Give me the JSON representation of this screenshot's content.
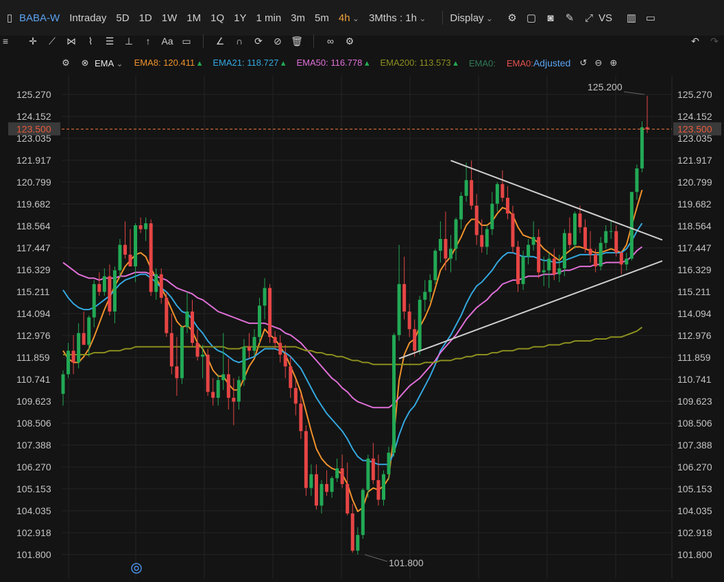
{
  "toolbar": {
    "symbol": "BABA-W",
    "periods": [
      "Intraday",
      "5D",
      "1D",
      "1W",
      "1M",
      "1Q",
      "1Y",
      "1 min",
      "3m",
      "5m",
      "4h"
    ],
    "active_period": "4h",
    "range": "3Mths : 1h",
    "display": "Display",
    "vs": "VS"
  },
  "drawing_tools": {
    "text_tool": "Aa"
  },
  "indicator": {
    "name": "EMA",
    "lines": [
      {
        "label": "EMA8:",
        "value": "120.411",
        "color": "#f0922c"
      },
      {
        "label": "EMA21:",
        "value": "118.727",
        "color": "#34a8e0"
      },
      {
        "label": "EMA50:",
        "value": "116.778",
        "color": "#e070d8"
      },
      {
        "label": "EMA200:",
        "value": "113.573",
        "color": "#8c8f1e"
      },
      {
        "label": "EMA0:",
        "value": "",
        "color": "#2f7a56"
      },
      {
        "label": "EMA0:",
        "value": "",
        "color": "#e85050"
      }
    ],
    "adjusted": "Adjusted"
  },
  "colors": {
    "up": "#22a955",
    "down": "#e64545",
    "price_line": "#f07a3c",
    "trendline": "#cfcfcf"
  },
  "chart_data": {
    "type": "candlestick",
    "y_ticks": [
      "125.270",
      "124.152",
      "123.035",
      "121.917",
      "120.799",
      "119.682",
      "118.564",
      "117.447",
      "116.329",
      "115.211",
      "114.094",
      "112.976",
      "111.859",
      "110.741",
      "109.623",
      "108.506",
      "107.388",
      "106.270",
      "105.153",
      "104.035",
      "102.918",
      "101.800"
    ],
    "ylim": [
      101.8,
      125.27
    ],
    "current_price": "123.500",
    "high_label": "125.200",
    "low_label": "101.800",
    "candles": [
      [
        110.0,
        111.2,
        109.4,
        111.0
      ],
      [
        111.0,
        112.6,
        110.8,
        112.2
      ],
      [
        112.2,
        113.0,
        111.0,
        111.6
      ],
      [
        111.6,
        113.6,
        111.3,
        113.1
      ],
      [
        113.1,
        114.2,
        112.7,
        112.5
      ],
      [
        112.5,
        114.0,
        111.9,
        113.9
      ],
      [
        113.9,
        115.8,
        113.4,
        115.6
      ],
      [
        115.6,
        116.2,
        115.0,
        115.2
      ],
      [
        115.2,
        116.4,
        115.0,
        116.0
      ],
      [
        116.0,
        116.6,
        114.0,
        114.2
      ],
      [
        114.2,
        116.5,
        113.6,
        116.3
      ],
      [
        116.3,
        117.9,
        115.9,
        117.6
      ],
      [
        117.6,
        118.8,
        116.9,
        117.1
      ],
      [
        117.1,
        118.4,
        116.5,
        116.5
      ],
      [
        116.5,
        118.7,
        115.7,
        118.6
      ],
      [
        118.6,
        119.0,
        118.2,
        118.4
      ],
      [
        118.4,
        119.0,
        117.8,
        118.7
      ],
      [
        118.7,
        118.9,
        115.0,
        115.2
      ],
      [
        115.2,
        116.4,
        114.8,
        116.1
      ],
      [
        116.1,
        116.4,
        114.6,
        114.9
      ],
      [
        114.9,
        115.2,
        112.9,
        113.1
      ],
      [
        113.1,
        114.1,
        111.0,
        111.4
      ],
      [
        111.4,
        112.9,
        109.9,
        110.8
      ],
      [
        110.8,
        113.5,
        110.5,
        113.4
      ],
      [
        113.4,
        115.2,
        113.1,
        114.2
      ],
      [
        114.2,
        114.8,
        112.4,
        112.6
      ],
      [
        112.6,
        113.3,
        111.7,
        111.9
      ],
      [
        111.9,
        112.5,
        110.8,
        112.0
      ],
      [
        112.0,
        112.3,
        109.9,
        110.1
      ],
      [
        110.1,
        110.8,
        109.4,
        109.8
      ],
      [
        109.8,
        111.0,
        109.4,
        110.7
      ],
      [
        110.7,
        113.1,
        110.2,
        111.0
      ],
      [
        111.0,
        111.8,
        109.2,
        109.8
      ],
      [
        109.8,
        110.8,
        108.4,
        109.6
      ],
      [
        109.6,
        110.9,
        109.2,
        110.7
      ],
      [
        110.7,
        112.8,
        110.4,
        112.4
      ],
      [
        112.4,
        113.1,
        111.8,
        112.2
      ],
      [
        112.2,
        113.3,
        111.9,
        112.9
      ],
      [
        112.9,
        114.9,
        112.6,
        114.5
      ],
      [
        114.5,
        115.9,
        113.8,
        115.4
      ],
      [
        115.4,
        115.6,
        112.6,
        112.9
      ],
      [
        112.9,
        113.2,
        112.3,
        112.6
      ],
      [
        112.6,
        113.0,
        111.6,
        112.0
      ],
      [
        112.0,
        112.5,
        110.8,
        111.4
      ],
      [
        111.4,
        111.9,
        109.8,
        110.3
      ],
      [
        110.3,
        110.7,
        108.9,
        109.5
      ],
      [
        109.5,
        110.0,
        107.7,
        108.1
      ],
      [
        108.1,
        108.4,
        104.8,
        105.2
      ],
      [
        105.2,
        106.4,
        104.8,
        105.9
      ],
      [
        105.9,
        106.4,
        104.1,
        104.3
      ],
      [
        104.3,
        105.6,
        103.9,
        105.4
      ],
      [
        105.4,
        106.1,
        104.8,
        105.0
      ],
      [
        105.0,
        105.8,
        104.7,
        105.7
      ],
      [
        105.7,
        106.7,
        105.5,
        106.2
      ],
      [
        106.2,
        106.9,
        105.2,
        105.4
      ],
      [
        105.4,
        106.5,
        103.8,
        103.9
      ],
      [
        103.9,
        104.4,
        101.9,
        102.0
      ],
      [
        102.0,
        103.2,
        101.8,
        102.8
      ],
      [
        102.8,
        105.2,
        102.6,
        105.1
      ],
      [
        105.1,
        106.9,
        104.7,
        106.7
      ],
      [
        106.7,
        107.5,
        105.4,
        105.6
      ],
      [
        105.6,
        106.9,
        104.3,
        104.6
      ],
      [
        104.6,
        106.1,
        104.3,
        105.9
      ],
      [
        105.9,
        107.3,
        105.6,
        107.0
      ],
      [
        107.0,
        113.1,
        106.8,
        113.0
      ],
      [
        113.0,
        117.6,
        112.7,
        115.6
      ],
      [
        115.6,
        117.0,
        113.8,
        114.2
      ],
      [
        114.2,
        114.6,
        112.9,
        113.3
      ],
      [
        113.3,
        113.8,
        111.9,
        112.2
      ],
      [
        112.2,
        115.0,
        112.0,
        114.8
      ],
      [
        114.8,
        115.8,
        114.2,
        115.2
      ],
      [
        115.2,
        116.1,
        114.7,
        115.8
      ],
      [
        115.8,
        117.4,
        115.6,
        117.3
      ],
      [
        117.3,
        118.8,
        116.7,
        117.9
      ],
      [
        117.9,
        119.3,
        116.3,
        116.9
      ],
      [
        116.9,
        118.1,
        116.2,
        117.4
      ],
      [
        117.4,
        119.0,
        116.8,
        118.9
      ],
      [
        118.9,
        120.3,
        118.4,
        120.1
      ],
      [
        120.1,
        121.8,
        119.8,
        120.9
      ],
      [
        120.9,
        121.9,
        119.4,
        119.6
      ],
      [
        119.6,
        120.2,
        117.6,
        118.1
      ],
      [
        118.1,
        118.9,
        117.2,
        117.5
      ],
      [
        117.5,
        118.6,
        117.1,
        118.4
      ],
      [
        118.4,
        120.3,
        118.1,
        119.7
      ],
      [
        119.7,
        120.8,
        119.3,
        120.7
      ],
      [
        120.7,
        121.4,
        119.8,
        120.0
      ],
      [
        120.0,
        120.6,
        118.9,
        119.2
      ],
      [
        119.2,
        119.6,
        117.2,
        117.5
      ],
      [
        117.5,
        117.8,
        115.2,
        115.6
      ],
      [
        115.6,
        117.3,
        115.3,
        117.0
      ],
      [
        117.0,
        117.9,
        116.6,
        117.6
      ],
      [
        117.6,
        118.8,
        117.3,
        118.0
      ],
      [
        118.0,
        118.4,
        115.9,
        116.2
      ],
      [
        116.2,
        117.0,
        115.5,
        116.3
      ],
      [
        116.3,
        117.2,
        115.4,
        116.9
      ],
      [
        116.9,
        117.4,
        115.8,
        116.1
      ],
      [
        116.1,
        117.1,
        115.7,
        116.4
      ],
      [
        116.4,
        118.4,
        116.0,
        118.2
      ],
      [
        118.2,
        119.0,
        117.4,
        117.6
      ],
      [
        117.6,
        119.3,
        117.4,
        119.2
      ],
      [
        119.2,
        119.6,
        118.2,
        118.5
      ],
      [
        118.5,
        118.9,
        117.2,
        117.4
      ],
      [
        117.4,
        118.3,
        116.7,
        117.1
      ],
      [
        117.1,
        117.4,
        116.2,
        116.5
      ],
      [
        116.5,
        118.0,
        116.3,
        117.7
      ],
      [
        117.7,
        118.6,
        117.4,
        118.3
      ],
      [
        118.3,
        118.8,
        117.9,
        118.3
      ],
      [
        118.3,
        118.6,
        117.0,
        117.2
      ],
      [
        117.2,
        117.3,
        116.1,
        116.6
      ],
      [
        116.6,
        117.2,
        116.3,
        116.9
      ],
      [
        116.9,
        119.4,
        116.8,
        120.3
      ],
      [
        120.3,
        121.7,
        119.9,
        121.5
      ],
      [
        121.5,
        123.9,
        121.3,
        123.6
      ],
      [
        123.6,
        125.2,
        123.3,
        123.5
      ]
    ],
    "series": [
      {
        "name": "EMA8",
        "color": "#f0922c",
        "values": [
          112.2,
          111.8,
          111.6,
          111.6,
          111.9,
          112.3,
          112.9,
          113.6,
          114.3,
          114.9,
          115.5,
          116.0,
          116.5,
          116.8,
          117.1,
          117.2,
          117.0,
          116.4,
          115.9,
          115.4,
          114.9,
          114.3,
          113.7,
          113.4,
          113.5,
          113.2,
          112.6,
          112.3,
          111.8,
          111.2,
          110.9,
          110.9,
          110.5,
          110.2,
          110.2,
          110.8,
          111.4,
          111.8,
          112.6,
          113.3,
          113.0,
          112.8,
          112.4,
          112.0,
          111.4,
          110.8,
          110.1,
          109.1,
          108.1,
          107.2,
          106.7,
          106.4,
          106.2,
          106.1,
          105.9,
          105.4,
          104.6,
          104.0,
          104.2,
          105.0,
          105.2,
          105.1,
          105.3,
          105.7,
          107.9,
          110.7,
          112.0,
          112.6,
          112.8,
          113.4,
          113.9,
          114.5,
          115.4,
          116.3,
          116.7,
          117.0,
          117.5,
          118.0,
          118.6,
          118.9,
          118.9,
          118.6,
          118.6,
          118.8,
          119.2,
          119.5,
          119.4,
          119.1,
          118.5,
          118.1,
          118.0,
          117.9,
          117.7,
          117.4,
          117.2,
          117.0,
          116.8,
          117.1,
          117.3,
          117.5,
          117.5,
          117.4,
          117.3,
          117.2,
          117.2,
          117.3,
          117.4,
          117.3,
          117.2,
          117.6,
          118.6,
          119.5,
          120.4
        ]
      },
      {
        "name": "EMA21",
        "color": "#34a8e0",
        "values": [
          115.3,
          114.9,
          114.6,
          114.4,
          114.3,
          114.3,
          114.4,
          114.6,
          114.8,
          115.0,
          115.3,
          115.6,
          115.8,
          115.9,
          116.0,
          116.1,
          116.1,
          115.9,
          115.7,
          115.4,
          115.2,
          114.9,
          114.5,
          114.2,
          114.1,
          113.8,
          113.4,
          113.1,
          112.7,
          112.4,
          112.2,
          112.1,
          111.9,
          111.7,
          111.6,
          111.7,
          111.8,
          111.9,
          112.1,
          112.3,
          112.3,
          112.3,
          112.2,
          112.1,
          111.9,
          111.6,
          111.3,
          110.8,
          110.3,
          109.8,
          109.4,
          109.0,
          108.7,
          108.4,
          108.1,
          107.7,
          107.2,
          106.8,
          106.6,
          106.6,
          106.5,
          106.4,
          106.4,
          106.4,
          107.0,
          107.9,
          108.6,
          109.1,
          109.4,
          109.9,
          110.4,
          110.9,
          111.5,
          112.2,
          112.6,
          113.0,
          113.5,
          114.0,
          114.6,
          115.1,
          115.5,
          115.7,
          116.0,
          116.3,
          116.7,
          117.0,
          117.2,
          117.2,
          117.1,
          117.0,
          117.0,
          117.0,
          116.9,
          116.8,
          116.8,
          116.7,
          116.7,
          116.8,
          116.9,
          117.0,
          117.1,
          117.1,
          117.1,
          117.1,
          117.1,
          117.2,
          117.2,
          117.2,
          117.2,
          117.4,
          117.8,
          118.3,
          118.7
        ]
      },
      {
        "name": "EMA50",
        "color": "#e070d8",
        "values": [
          116.7,
          116.5,
          116.3,
          116.1,
          116.0,
          115.9,
          115.9,
          115.8,
          115.9,
          115.9,
          115.9,
          116.0,
          116.0,
          116.1,
          116.2,
          116.2,
          116.2,
          116.1,
          116.0,
          115.9,
          115.8,
          115.6,
          115.4,
          115.3,
          115.2,
          115.1,
          114.9,
          114.8,
          114.6,
          114.4,
          114.2,
          114.1,
          114.0,
          113.9,
          113.8,
          113.7,
          113.6,
          113.6,
          113.6,
          113.6,
          113.5,
          113.4,
          113.3,
          113.1,
          113.0,
          112.8,
          112.6,
          112.3,
          112.0,
          111.7,
          111.4,
          111.1,
          110.8,
          110.6,
          110.3,
          110.1,
          109.8,
          109.6,
          109.5,
          109.4,
          109.3,
          109.3,
          109.3,
          109.3,
          109.5,
          109.8,
          110.1,
          110.4,
          110.6,
          110.8,
          111.1,
          111.4,
          111.7,
          112.1,
          112.4,
          112.7,
          113.0,
          113.4,
          113.8,
          114.1,
          114.4,
          114.6,
          114.8,
          115.1,
          115.3,
          115.6,
          115.7,
          115.8,
          115.8,
          115.9,
          116.0,
          116.0,
          116.0,
          116.1,
          116.1,
          116.1,
          116.2,
          116.3,
          116.3,
          116.4,
          116.5,
          116.5,
          116.5,
          116.6,
          116.6,
          116.7,
          116.7,
          116.7,
          116.7,
          116.8,
          117.0,
          117.3,
          117.5
        ]
      },
      {
        "name": "EMA200",
        "color": "#8c8f1e",
        "values": [
          112.0,
          112.0,
          112.0,
          112.0,
          112.0,
          112.0,
          112.1,
          112.1,
          112.1,
          112.2,
          112.2,
          112.2,
          112.3,
          112.3,
          112.4,
          112.4,
          112.4,
          112.4,
          112.4,
          112.4,
          112.4,
          112.4,
          112.4,
          112.4,
          112.4,
          112.4,
          112.4,
          112.4,
          112.4,
          112.4,
          112.4,
          112.4,
          112.3,
          112.3,
          112.3,
          112.4,
          112.4,
          112.4,
          112.4,
          112.4,
          112.4,
          112.4,
          112.4,
          112.4,
          112.4,
          112.4,
          112.3,
          112.2,
          112.2,
          112.1,
          112.1,
          112.0,
          112.0,
          111.9,
          111.9,
          111.8,
          111.7,
          111.7,
          111.6,
          111.6,
          111.5,
          111.5,
          111.5,
          111.5,
          111.5,
          111.5,
          111.5,
          111.5,
          111.5,
          111.5,
          111.6,
          111.6,
          111.6,
          111.7,
          111.7,
          111.7,
          111.8,
          111.8,
          111.9,
          111.9,
          112.0,
          112.0,
          112.0,
          112.1,
          112.1,
          112.2,
          112.2,
          112.2,
          112.3,
          112.3,
          112.3,
          112.4,
          112.4,
          112.4,
          112.5,
          112.5,
          112.5,
          112.6,
          112.6,
          112.7,
          112.7,
          112.7,
          112.7,
          112.8,
          112.8,
          112.8,
          112.9,
          112.9,
          112.9,
          113.0,
          113.1,
          113.2,
          113.4
        ]
      }
    ],
    "trendlines": [
      {
        "x1": 75,
        "y1": 121.9,
        "x2": 113,
        "y2": 118.2
      },
      {
        "x1": 65,
        "y1": 111.8,
        "x2": 113,
        "y2": 116.5
      }
    ]
  }
}
